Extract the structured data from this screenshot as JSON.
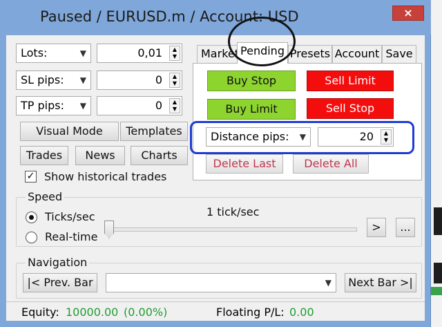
{
  "window": {
    "title": "Paused / EURUSD.m / Account: USD",
    "close_glyph": "×"
  },
  "left": {
    "lots_label": "Lots:",
    "lots_value": "0,01",
    "sl_label": "SL pips:",
    "sl_value": "0",
    "tp_label": "TP pips:",
    "tp_value": "0",
    "visual_mode": "Visual Mode",
    "templates": "Templates",
    "trades": "Trades",
    "news": "News",
    "charts": "Charts",
    "show_historical": "Show historical trades",
    "show_historical_checked": true
  },
  "tabs": [
    {
      "label": "Market"
    },
    {
      "label": "Pending"
    },
    {
      "label": "Presets"
    },
    {
      "label": "Account"
    },
    {
      "label": "Save"
    }
  ],
  "pending": {
    "buy_stop": "Buy Stop",
    "sell_limit": "Sell Limit",
    "buy_limit": "Buy Limit",
    "sell_stop": "Sell Stop",
    "distance_label": "Distance pips:",
    "distance_value": "20",
    "delete_last": "Delete Last",
    "delete_all": "Delete All"
  },
  "speed": {
    "title": "Speed",
    "ticks_label": "Ticks/sec",
    "realtime_label": "Real-time",
    "rate_text": "1 tick/sec",
    "selected": "Ticks/sec",
    "step_btn": ">",
    "more_btn": "..."
  },
  "navigation": {
    "title": "Navigation",
    "prev_bar": "|< Prev. Bar",
    "next_bar": "Next Bar >|",
    "select_value": ""
  },
  "status": {
    "equity_label": "Equity:",
    "equity_value": "10000.00",
    "equity_pct": "(0.00%)",
    "floating_label": "Floating P/L:",
    "floating_value": "0.00"
  },
  "colors": {
    "titlebar": "#7fa7d9",
    "green_button": "#8dd42f",
    "red_button": "#f40d0d",
    "highlight": "#1e3bd2",
    "positive_text": "#1f9d2f"
  },
  "icons": {
    "dropdown": "chevron-down-icon",
    "spin": "spin-up-down-icon",
    "close": "close-icon"
  }
}
